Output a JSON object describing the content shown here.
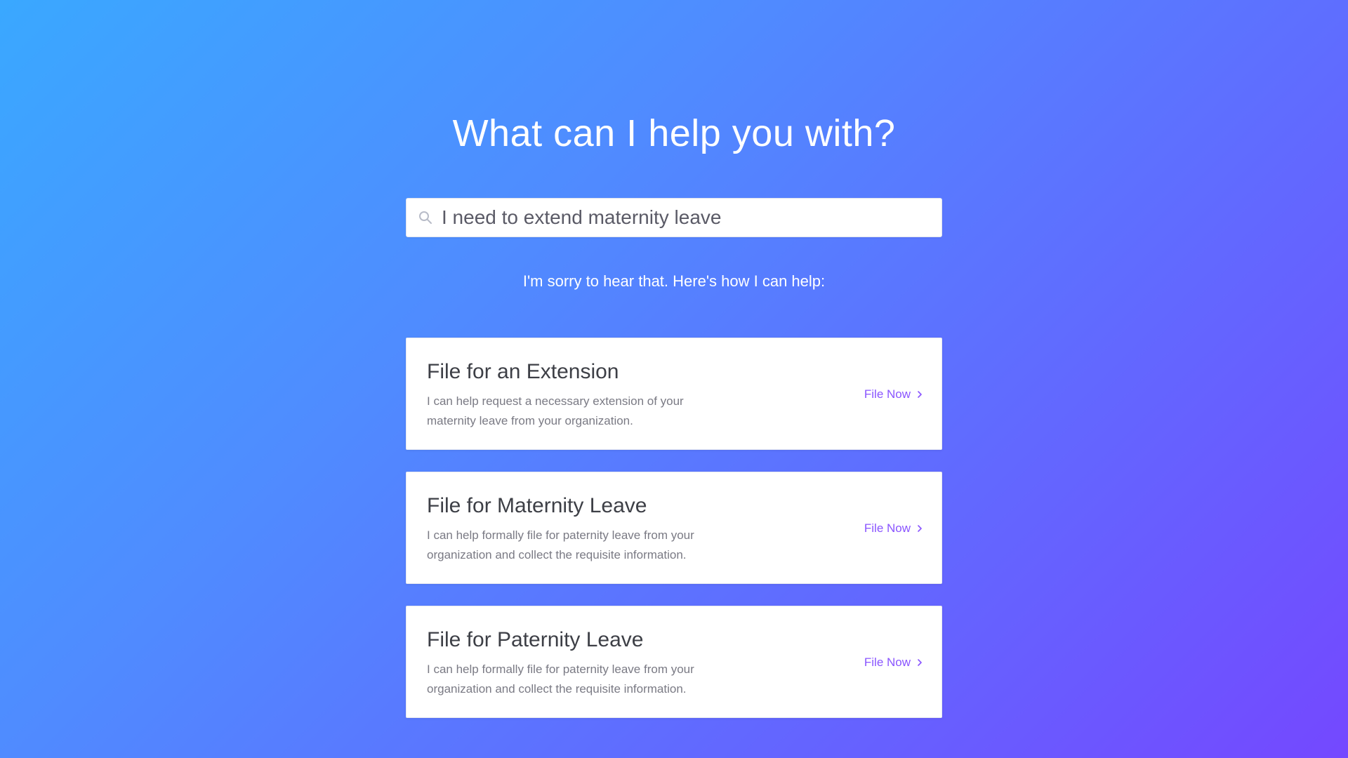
{
  "header": {
    "title": "What can I help you with?"
  },
  "search": {
    "value": "I need to extend maternity leave",
    "icon": "search-icon"
  },
  "response": {
    "message": "I'm sorry to hear that. Here's how I can help:"
  },
  "cards": [
    {
      "title": "File for an Extension",
      "description": "I can help request a necessary extension of your maternity leave from your organization.",
      "action_label": "File Now",
      "action_icon": "chevron-right-icon"
    },
    {
      "title": "File for Maternity Leave",
      "description": "I can help formally file for paternity leave from your organization and collect the requisite information.",
      "action_label": "File Now",
      "action_icon": "chevron-right-icon"
    },
    {
      "title": "File for Paternity Leave",
      "description": "I can help formally file for paternity leave from your organization and collect the requisite information.",
      "action_label": "File Now",
      "action_icon": "chevron-right-icon"
    }
  ],
  "colors": {
    "gradient_start": "#3aa8ff",
    "gradient_end": "#7448ff",
    "accent": "#8a55ff",
    "card_background": "#ffffff"
  }
}
